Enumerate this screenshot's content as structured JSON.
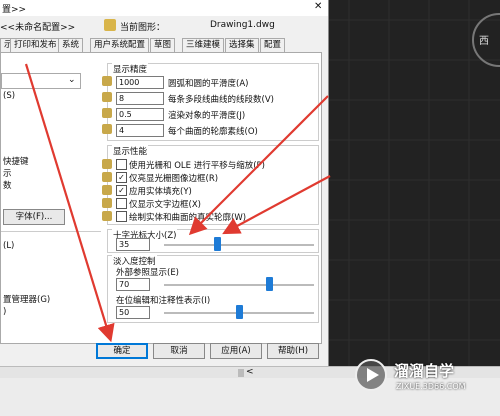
{
  "dialog": {
    "titlebar": {
      "partial_text": "置>>",
      "close_glyph": "✕"
    },
    "current_profile_label": "<<未命名配置>>",
    "current_drawing_label": "当前图形：",
    "drawing_name": "Drawing1.dwg",
    "tabs": [
      "打印和发布",
      "系统",
      "用户系统配置",
      "草图",
      "三维建模",
      "选择集",
      "配置"
    ],
    "tab_partial_left": "示",
    "left_column": {
      "label_s": "(S)",
      "label_shortcut": "快捷键",
      "label_show": "示",
      "label_count": "数",
      "font_button": "字体(F)...",
      "label_l": "(L)",
      "label_manager": "置管理器(G)",
      "label_paren": ")"
    },
    "display_resolution": {
      "title": "显示精度",
      "rows": [
        {
          "value": "1000",
          "label": "圆弧和圆的平滑度(A)"
        },
        {
          "value": "8",
          "label": "每条多段线曲线的线段数(V)"
        },
        {
          "value": "0.5",
          "label": "渲染对象的平滑度(J)"
        },
        {
          "value": "4",
          "label": "每个曲面的轮廓素线(O)"
        }
      ]
    },
    "display_performance": {
      "title": "显示性能",
      "rows": [
        {
          "checked": false,
          "label": "使用光栅和 OLE 进行平移与缩放(P)"
        },
        {
          "checked": true,
          "label": "仅亮显光栅图像边框(R)"
        },
        {
          "checked": true,
          "label": "应用实体填充(Y)"
        },
        {
          "checked": false,
          "label": "仅显示文字边框(X)"
        },
        {
          "checked": false,
          "label": "绘制实体和曲面的真实轮廓(W)"
        }
      ]
    },
    "crosshair": {
      "title": "十字光标大小(Z)",
      "value": "35",
      "level": 0.35
    },
    "fade_control": {
      "title": "淡入度控制",
      "xref_label": "外部参照显示(E)",
      "xref_value": "70",
      "xref_level": 0.7,
      "inplace_label": "在位编辑和注释性表示(I)",
      "inplace_value": "50",
      "inplace_level": 0.5
    },
    "buttons": {
      "ok": "确定",
      "cancel": "取消",
      "apply": "应用(A)",
      "help": "帮助(H)"
    }
  },
  "canvas": {
    "view_label": "西"
  },
  "hscroll": {
    "left_arrow": "<"
  },
  "watermark": {
    "brand": "溜溜自学",
    "url": "ZIXUE.3D66.COM"
  },
  "colors": {
    "accent": "#0078d7",
    "annotation": "#e03a30",
    "slider": "#1e7bd6",
    "canvas": "#222222"
  }
}
